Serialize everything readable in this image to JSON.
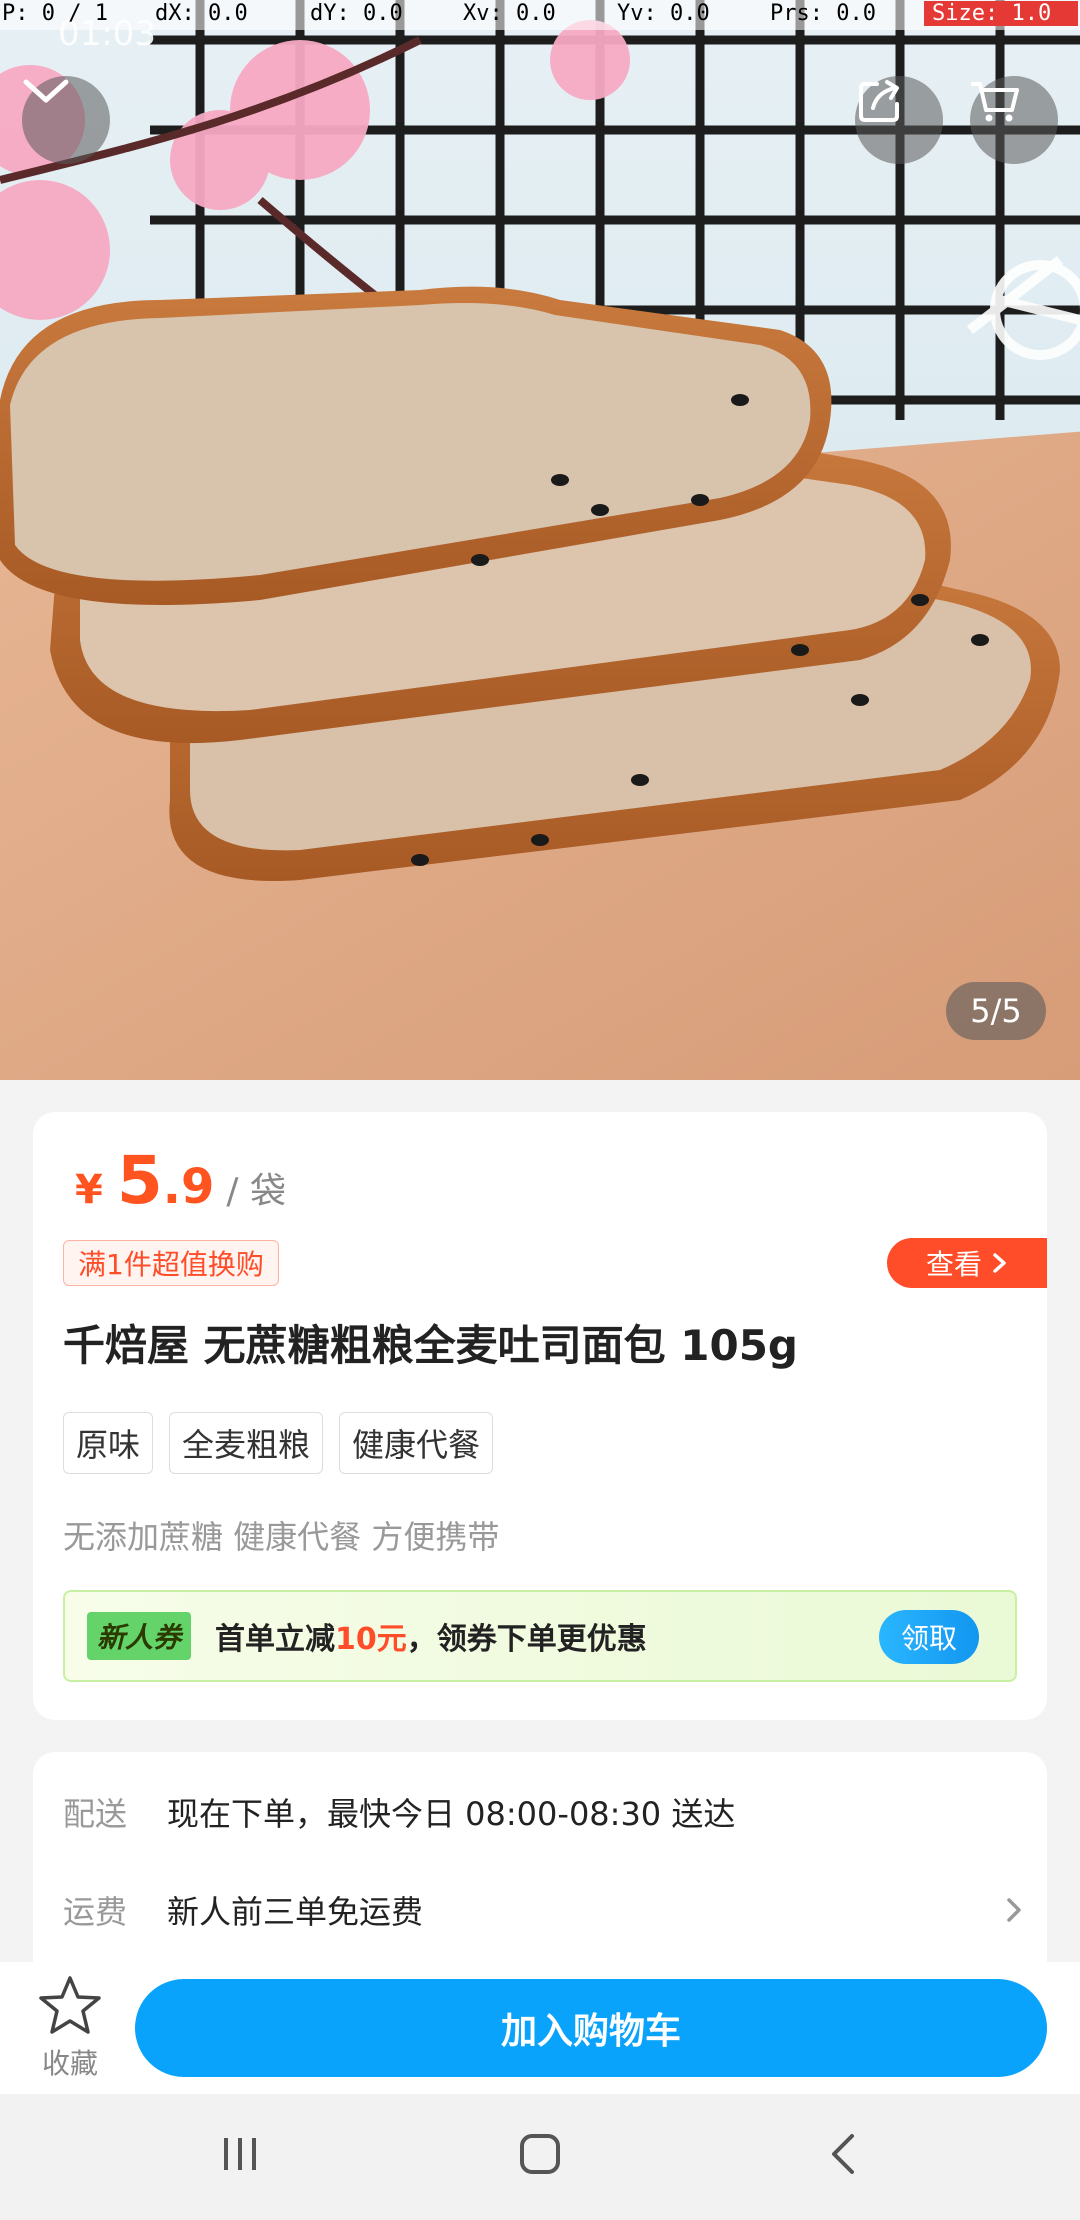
{
  "debug": {
    "p": "P: 0 / 1",
    "dx": "dX: 0.0",
    "dy": "dY: 0.0",
    "xv": "Xv: 0.0",
    "yv": "Yv: 0.0",
    "prs": "Prs: 0.0",
    "size": "Size: 1.0"
  },
  "status": {
    "time": "01:03"
  },
  "gallery": {
    "pager": "5/5"
  },
  "product": {
    "currency": "¥",
    "price_int": "5",
    "price_dec": ".9",
    "unit": "/ 袋",
    "promo_tag": "满1件超值换购",
    "view_label": "查看",
    "title": "千焙屋 无蔗糖粗粮全麦吐司面包 105g",
    "tags": [
      "原味",
      "全麦粗粮",
      "健康代餐"
    ],
    "subtitle": "无添加蔗糖 健康代餐 方便携带"
  },
  "coupon": {
    "badge": "新人券",
    "text_before": "首单立减",
    "amount": "10元",
    "text_after": "，领券下单更优惠",
    "button": "领取"
  },
  "delivery": {
    "label": "配送",
    "value": "现在下单，最快今日 08:00-08:30 送达"
  },
  "shipping": {
    "label": "运费",
    "value": "新人前三单免运费"
  },
  "bottom_bar": {
    "favorite_label": "收藏",
    "add_to_cart": "加入购物车"
  },
  "colors": {
    "price": "#ff5320",
    "primary": "#0aa3fb",
    "promo": "#ff4d2a"
  }
}
